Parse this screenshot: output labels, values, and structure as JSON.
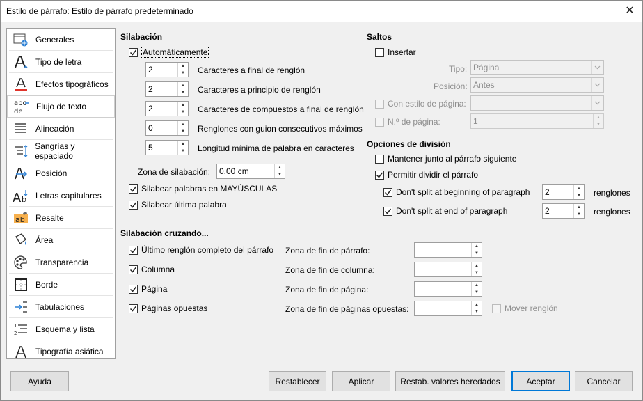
{
  "window": {
    "title": "Estilo de párrafo: Estilo de párrafo predeterminado",
    "close_glyph": "✕"
  },
  "sidebar": {
    "items": [
      {
        "label": "Generales",
        "icon": "general-settings-icon"
      },
      {
        "label": "Tipo de letra",
        "icon": "font-icon"
      },
      {
        "label": "Efectos tipográficos",
        "icon": "font-effects-icon"
      },
      {
        "label": "Flujo de texto",
        "icon": "text-flow-icon"
      },
      {
        "label": "Alineación",
        "icon": "alignment-icon"
      },
      {
        "label": "Sangrías y espaciado",
        "icon": "indent-spacing-icon"
      },
      {
        "label": "Posición",
        "icon": "position-icon"
      },
      {
        "label": "Letras capitulares",
        "icon": "drop-caps-icon"
      },
      {
        "label": "Resalte",
        "icon": "highlight-icon"
      },
      {
        "label": "Área",
        "icon": "area-fill-icon"
      },
      {
        "label": "Transparencia",
        "icon": "transparency-palette-icon"
      },
      {
        "label": "Borde",
        "icon": "border-icon"
      },
      {
        "label": "Tabulaciones",
        "icon": "tabs-icon"
      },
      {
        "label": "Esquema y lista",
        "icon": "outline-list-icon"
      },
      {
        "label": "Tipografía asiática",
        "icon": "asian-typography-icon"
      }
    ],
    "selected": "Flujo de texto"
  },
  "hyphenation": {
    "title": "Silabación",
    "auto_label": "Automáticamente",
    "auto_checked": true,
    "fields": [
      {
        "value": "2",
        "label": "Caracteres a final de renglón"
      },
      {
        "value": "2",
        "label": "Caracteres a principio de renglón"
      },
      {
        "value": "2",
        "label": "Caracteres de compuestos a final de renglón"
      },
      {
        "value": "0",
        "label": "Renglones con guion consecutivos máximos"
      },
      {
        "value": "5",
        "label": "Longitud mínima de palabra en caracteres"
      }
    ],
    "zone_label": "Zona de silabación:",
    "zone_value": "0,00 cm",
    "caps_label": "Silabear palabras en MAYÚSCULAS",
    "last_word_label": "Silabear última palabra"
  },
  "breaks": {
    "title": "Saltos",
    "insert_label": "Insertar",
    "type_label": "Tipo:",
    "type_value": "Página",
    "position_label": "Posición:",
    "position_value": "Antes",
    "page_style_label": "Con estilo de página:",
    "page_num_label": "N.º de página:",
    "page_num_value": "1"
  },
  "split": {
    "title": "Opciones de división",
    "keep_label": "Mantener junto al párrafo siguiente",
    "allow_label": "Permitir dividir el párrafo",
    "begin_label": "Don't split at beginning of paragraph",
    "begin_value": "2",
    "end_label": "Don't split at end of paragraph",
    "end_value": "2",
    "unit": "renglones"
  },
  "across": {
    "title": "Silabación cruzando...",
    "rows": [
      {
        "label": "Último renglón completo del párrafo",
        "zone": "Zona de fin de párrafo:"
      },
      {
        "label": "Columna",
        "zone": "Zona de fin de columna:"
      },
      {
        "label": "Página",
        "zone": "Zona de fin de página:"
      },
      {
        "label": "Páginas opuestas",
        "zone": "Zona de fin de páginas opuestas:"
      }
    ],
    "move_line_label": "Mover renglón"
  },
  "buttons": {
    "help": "Ayuda",
    "reset": "Restablecer",
    "apply": "Aplicar",
    "inherit": "Restab. valores heredados",
    "ok": "Aceptar",
    "cancel": "Cancelar"
  }
}
